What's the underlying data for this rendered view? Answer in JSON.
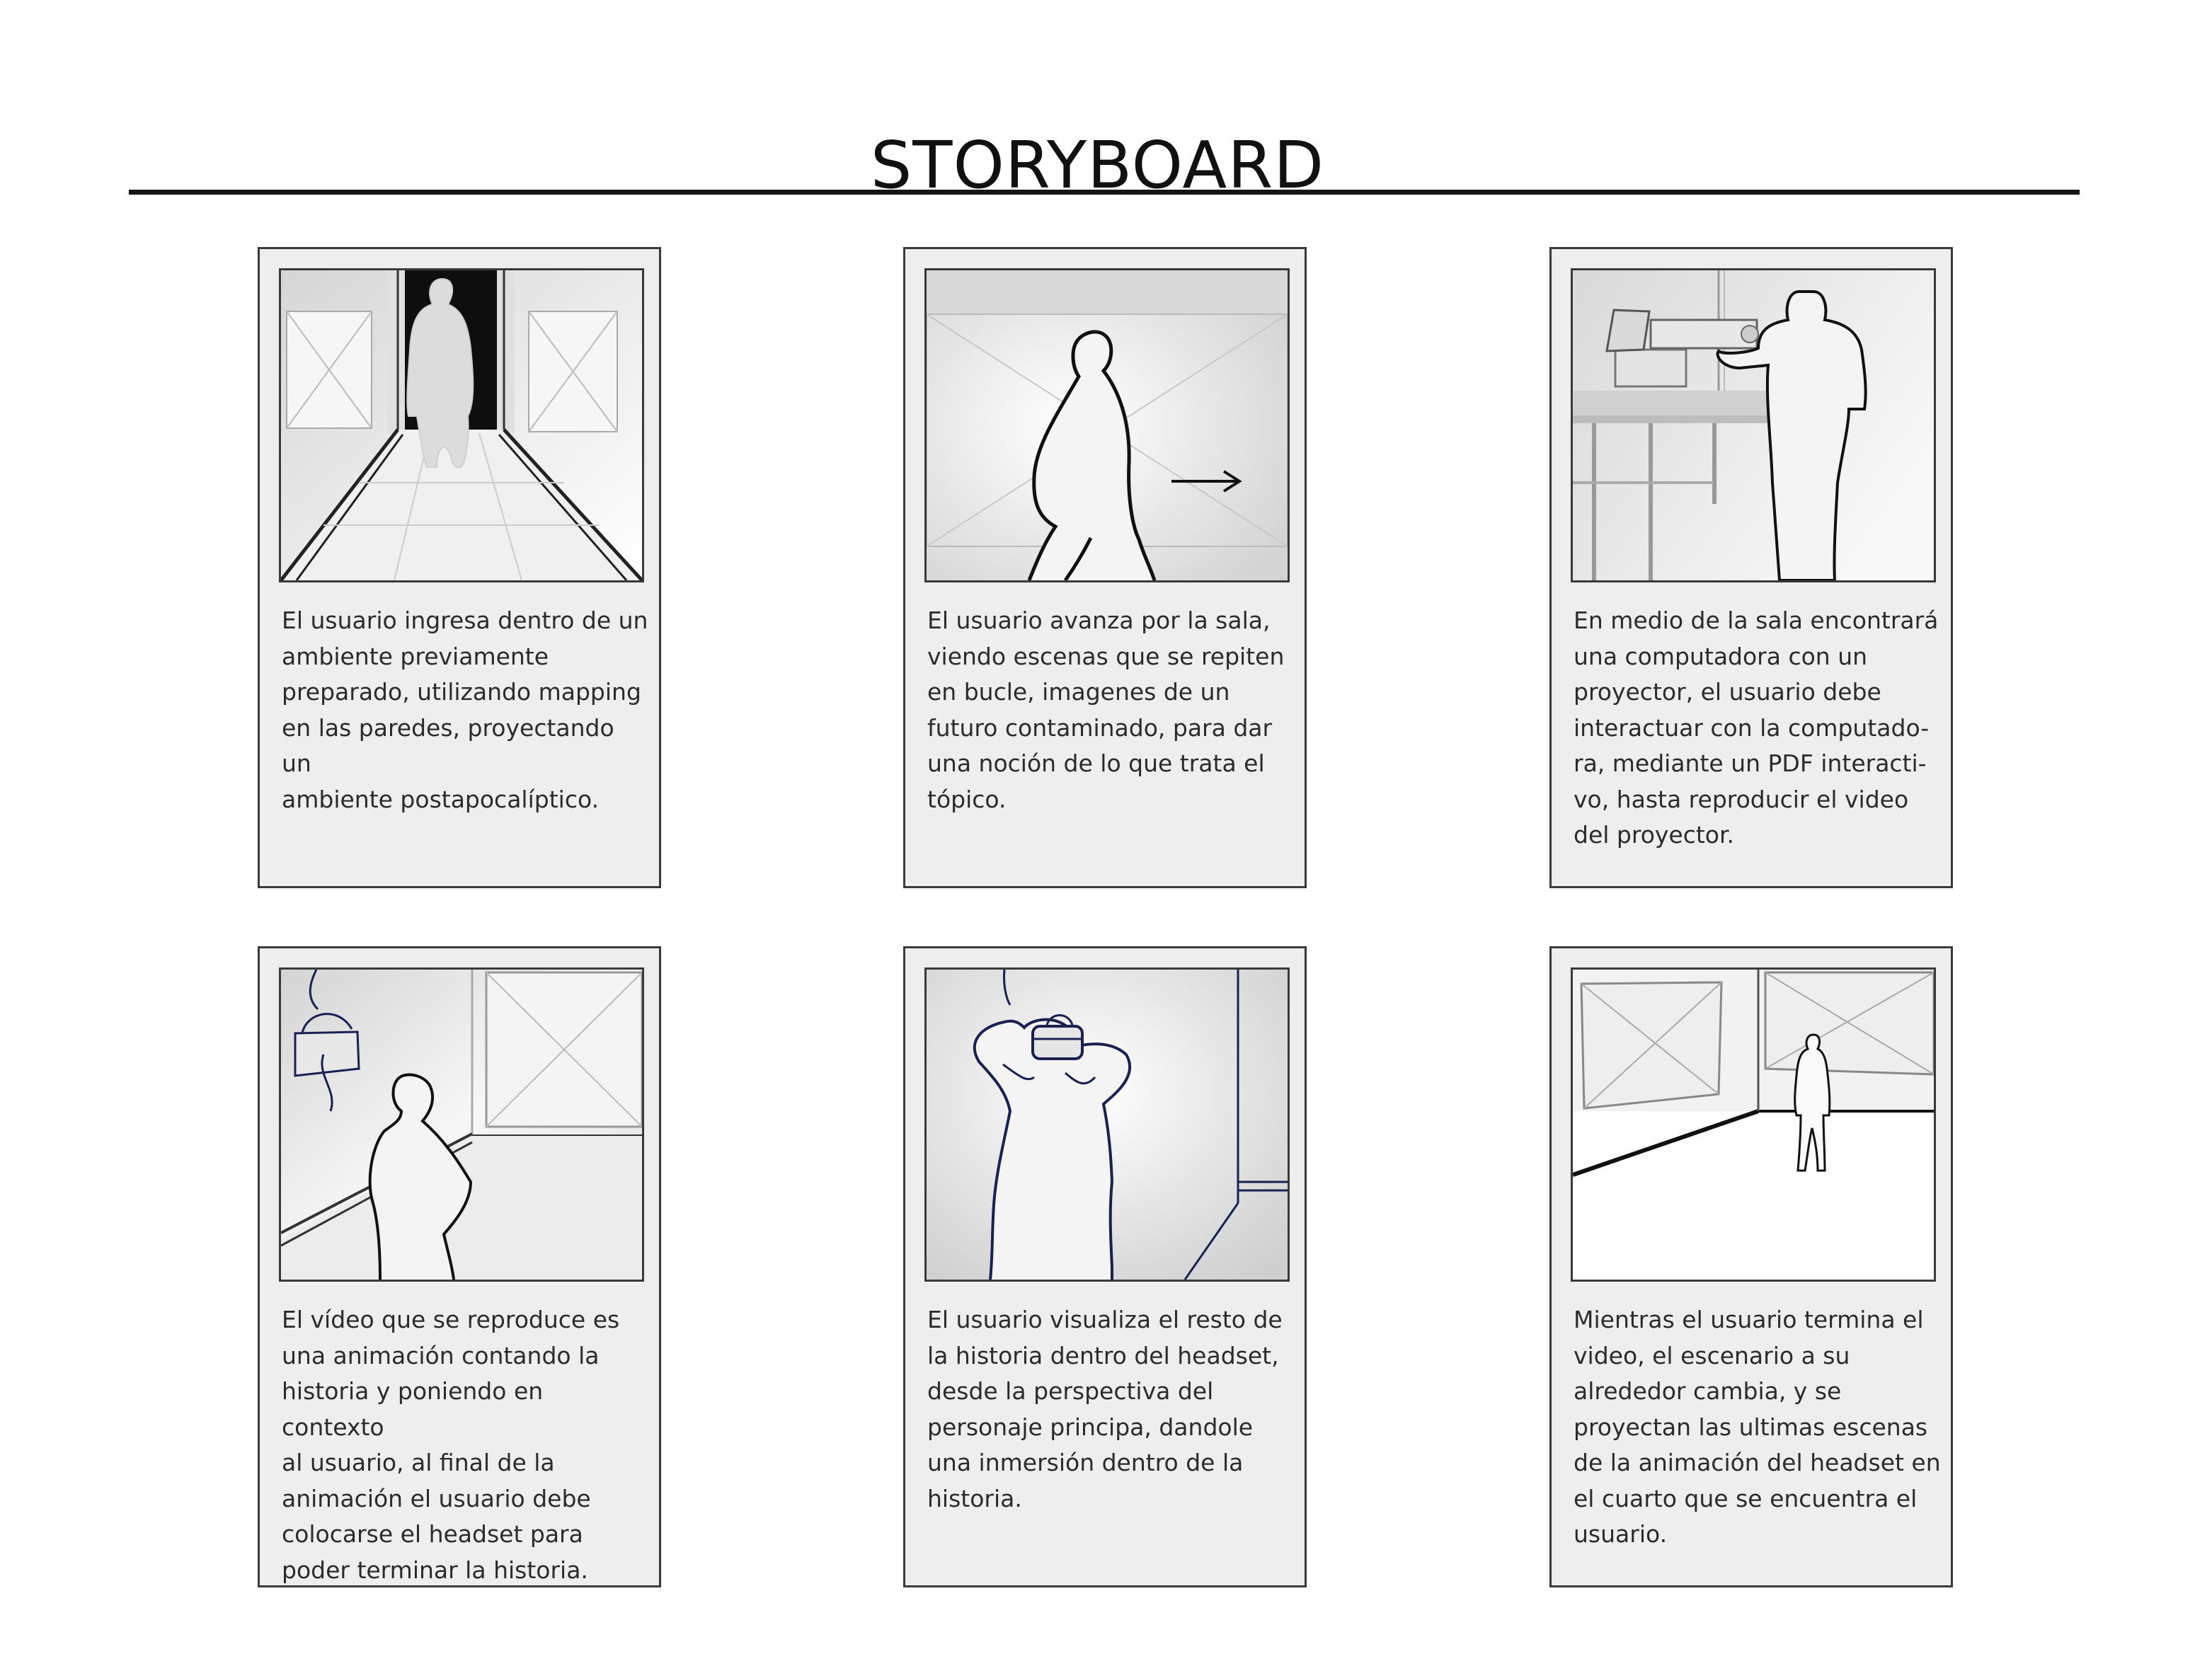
{
  "title": "STORYBOARD",
  "panels": [
    {
      "caption": "El usuario ingresa dentro de un\nambiente previamente\npreparado, utilizando mapping\nen las paredes, proyectando un\nambiente postapocalíptico."
    },
    {
      "caption": "El usuario avanza por la sala,\nviendo escenas que se repiten\nen bucle, imagenes de un\nfuturo contaminado, para dar\nuna noción de lo que trata el\ntópico."
    },
    {
      "caption": "En medio de la sala encontrará\nuna computadora con un\nproyector, el usuario debe\ninteractuar con la computado-\nra, mediante un PDF interacti-\nvo, hasta reproducir el video\ndel proyector."
    },
    {
      "caption": "El vídeo que se reproduce es\nuna animación contando la\nhistoria y poniendo en contexto\nal usuario, al final de la\nanimación el usuario debe\ncolocarse el headset para\npoder terminar la historia."
    },
    {
      "caption": "El usuario visualiza el resto de\nla historia dentro del headset,\ndesde la perspectiva del\npersonaje principa, dandole\nuna inmersión dentro de la\nhistoria."
    },
    {
      "caption": "Mientras el usuario termina el\nvideo, el escenario a su\nalrededor cambia, y se\nproyectan las ultimas escenas\nde la animación del headset en\nel cuarto que se encuentra el\nusuario."
    }
  ]
}
